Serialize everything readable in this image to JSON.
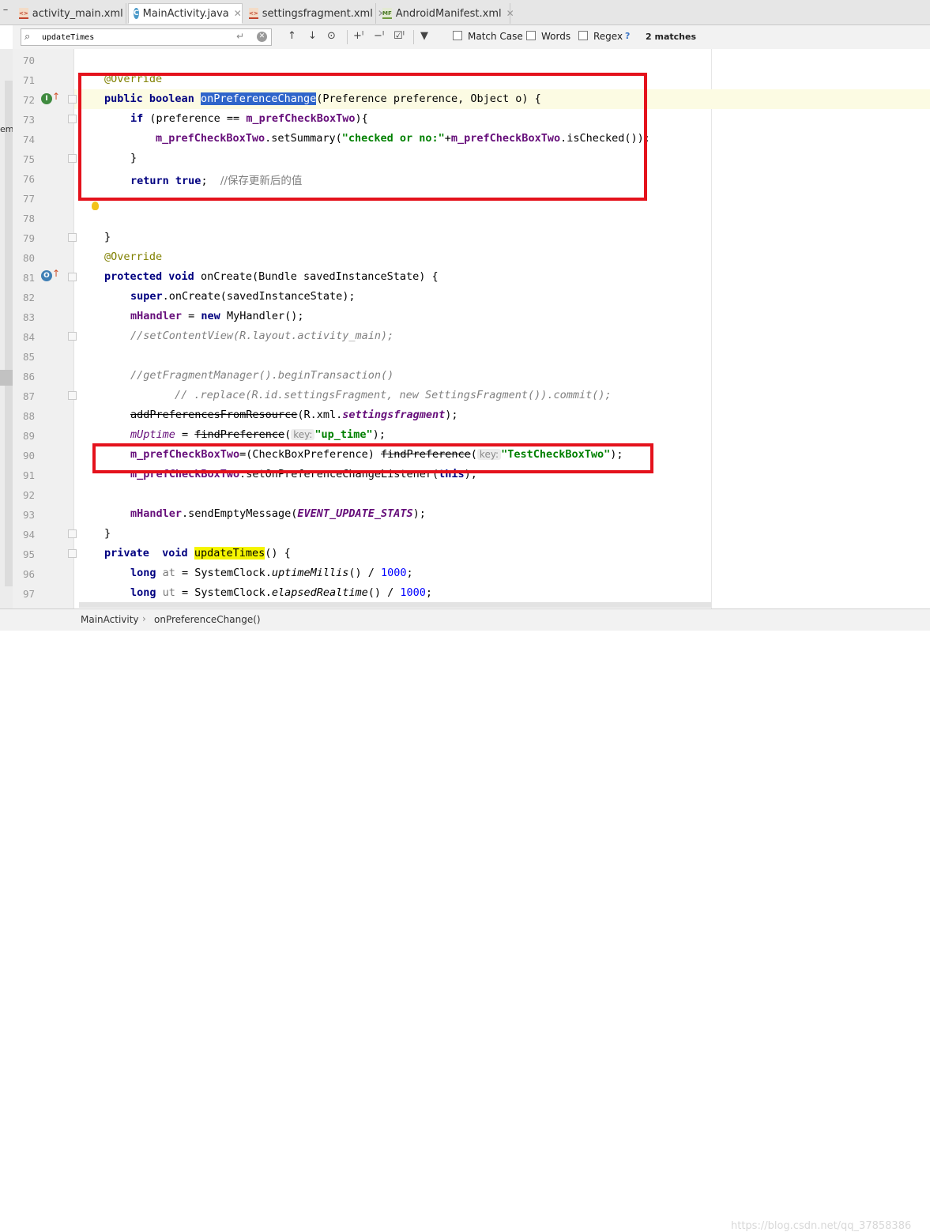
{
  "tabs": [
    {
      "label": "activity_main.xml",
      "icon": "xml-file-icon",
      "active": false
    },
    {
      "label": "MainActivity.java",
      "icon": "java-class-icon",
      "active": true
    },
    {
      "label": "settingsfragment.xml",
      "icon": "xml-file-icon",
      "active": false
    },
    {
      "label": "AndroidManifest.xml",
      "icon": "manifest-file-icon",
      "active": false
    }
  ],
  "search": {
    "query": "updateTimes",
    "match_case": "Match Case",
    "words": "Words",
    "regex": "Regex",
    "help": "?",
    "matches": "2 matches"
  },
  "left_strip_text": "em",
  "line_numbers": [
    "70",
    "71",
    "72",
    "73",
    "74",
    "75",
    "76",
    "77",
    "78",
    "79",
    "80",
    "81",
    "82",
    "83",
    "84",
    "85",
    "86",
    "87",
    "88",
    "89",
    "90",
    "91",
    "92",
    "93",
    "94",
    "95",
    "96",
    "97"
  ],
  "code": {
    "l71": {
      "a": "@Override"
    },
    "l72": {
      "kw1": "public",
      "kw2": "boolean",
      "sel": "onPreferenceChange",
      "rest": "(Preference preference, Object o) {"
    },
    "l73": {
      "kw": "if",
      "p1": " (preference == ",
      "f": "m_prefCheckBoxTwo",
      "p2": "){"
    },
    "l74": {
      "f": "m_prefCheckBoxTwo",
      "p1": ".setSummary(",
      "s": "\"checked or no:\"",
      "p2": "+",
      "f2": "m_prefCheckBoxTwo",
      "p3": ".isChecked());"
    },
    "l75": {
      "t": "}"
    },
    "l76": {
      "kw": "return",
      "kw2": "true",
      "p": ";  ",
      "c": "//保存更新后的值"
    },
    "l79": {
      "t": "}"
    },
    "l80": {
      "a": "@Override"
    },
    "l81": {
      "kw1": "protected",
      "kw2": "void",
      "rest": "onCreate(Bundle savedInstanceState) {"
    },
    "l82": {
      "kw": "super",
      "rest": ".onCreate(savedInstanceState);"
    },
    "l83": {
      "f": "mHandler",
      "p1": " = ",
      "kw": "new",
      "rest": " MyHandler();"
    },
    "l84": {
      "c": "//setContentView(R.layout.activity_main);"
    },
    "l86": {
      "c": "//getFragmentManager().beginTransaction()"
    },
    "l87": {
      "c": "// .replace(R.id.settingsFragment, new SettingsFragment()).commit();"
    },
    "l88": {
      "strike": "addPreferencesFromResource",
      "p1": "(R.xml.",
      "fi": "settingsfragment",
      "p2": ");"
    },
    "l89": {
      "fi": "mUptime",
      "p1": " = ",
      "strike": "findPreference",
      "p2": "(",
      "hint": "key:",
      "s": "\"up_time\"",
      "p3": ");"
    },
    "l90": {
      "f": "m_prefCheckBoxTwo",
      "p1": "=(CheckBoxPreference) ",
      "strike": "findPreference",
      "p2": "(",
      "hint": "key:",
      "s": "\"TestCheckBoxTwo\"",
      "p3": ");"
    },
    "l91": {
      "f": "m_prefCheckBoxTwo",
      "p1": ".setOnPreferenceChangeListener(",
      "kw": "this",
      "p2": ");"
    },
    "l93": {
      "f": "mHandler",
      "p1": ".sendEmptyMessage(",
      "fi": "EVENT_UPDATE_STATS",
      "p2": ");"
    },
    "l94": {
      "t": "}"
    },
    "l95": {
      "kw1": "private",
      "kw2": "void",
      "y": "updateTimes",
      "rest": "() {"
    },
    "l96": {
      "kw": "long",
      "v": "at",
      "p1": " = SystemClock.",
      "m": "uptimeMillis",
      "p2": "() / ",
      "n": "1000",
      "p3": ";"
    },
    "l97": {
      "kw": "long",
      "v": "ut",
      "p1": " = SystemClock.",
      "m": "elapsedRealtime",
      "p2": "() / ",
      "n": "1000",
      "p3": ";"
    }
  },
  "breadcrumb": [
    "MainActivity",
    "onPreferenceChange()"
  ],
  "watermark": "https://blog.csdn.net/qq_37858386",
  "colors": {
    "annotation_box": "#e4121c",
    "keyword": "#000080",
    "field": "#660e7a",
    "string": "#008000",
    "selection": "#2f65ca",
    "search_match": "#f5f500"
  }
}
